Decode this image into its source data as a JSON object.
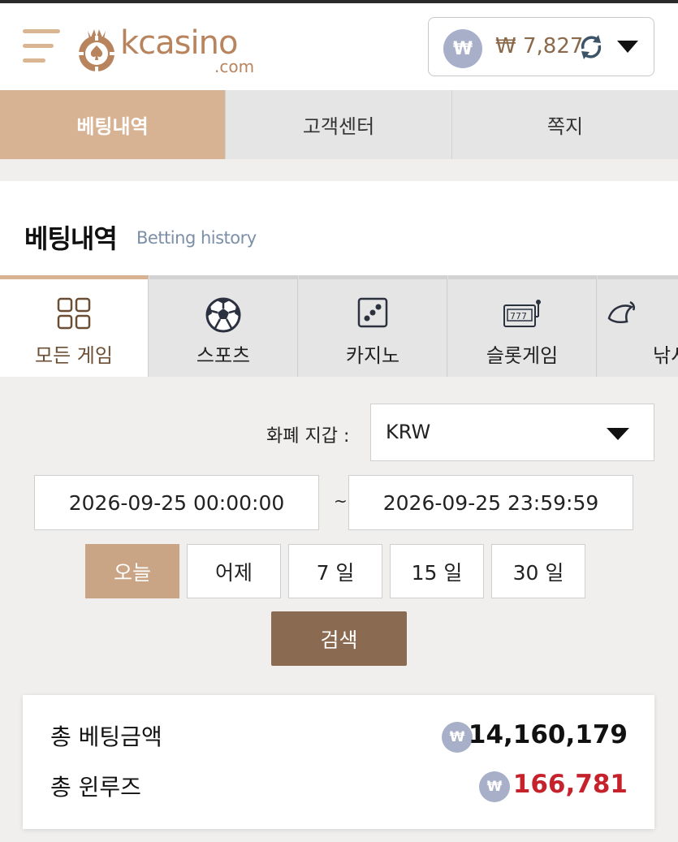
{
  "brand": {
    "name": "kcasino",
    "suffix": ".com"
  },
  "balance": {
    "currency_symbol": "₩",
    "amount": "₩ 7,827",
    "icon": "won-coin-icon"
  },
  "top_nav": [
    {
      "label": "베팅내역",
      "active": true
    },
    {
      "label": "고객센터",
      "active": false
    },
    {
      "label": "쪽지",
      "active": false
    }
  ],
  "section": {
    "title": "베팅내역",
    "subtitle": "Betting history"
  },
  "game_tabs": [
    {
      "label": "모든 게임",
      "icon": "grid-icon",
      "active": true
    },
    {
      "label": "스포츠",
      "icon": "soccer-ball-icon",
      "active": false
    },
    {
      "label": "카지노",
      "icon": "dice-icon",
      "active": false
    },
    {
      "label": "슬롯게임",
      "icon": "slot-machine-icon",
      "active": false
    },
    {
      "label": "낚시",
      "icon": "fish-icon",
      "active": false
    }
  ],
  "filter": {
    "currency_label": "화폐 지갑 :",
    "currency_value": "KRW",
    "date_from": "2026-09-25 00:00:00",
    "date_sep": "~",
    "date_to": "2026-09-25 23:59:59",
    "periods": [
      {
        "label": "오늘",
        "active": true
      },
      {
        "label": "어제",
        "active": false
      },
      {
        "label": "7 일",
        "active": false
      },
      {
        "label": "15 일",
        "active": false
      },
      {
        "label": "30 일",
        "active": false
      }
    ],
    "search_label": "검색"
  },
  "summary": {
    "total_bet_label": "총 베팅금액",
    "total_bet_value": "14,160,179",
    "total_winloss_label": "총 윈루즈",
    "total_winloss_value": "166,781",
    "won_symbol": "₩"
  },
  "colors": {
    "accent": "#d7b293",
    "brand": "#b8845e",
    "search": "#8a6a50",
    "negative": "#c6222c"
  }
}
